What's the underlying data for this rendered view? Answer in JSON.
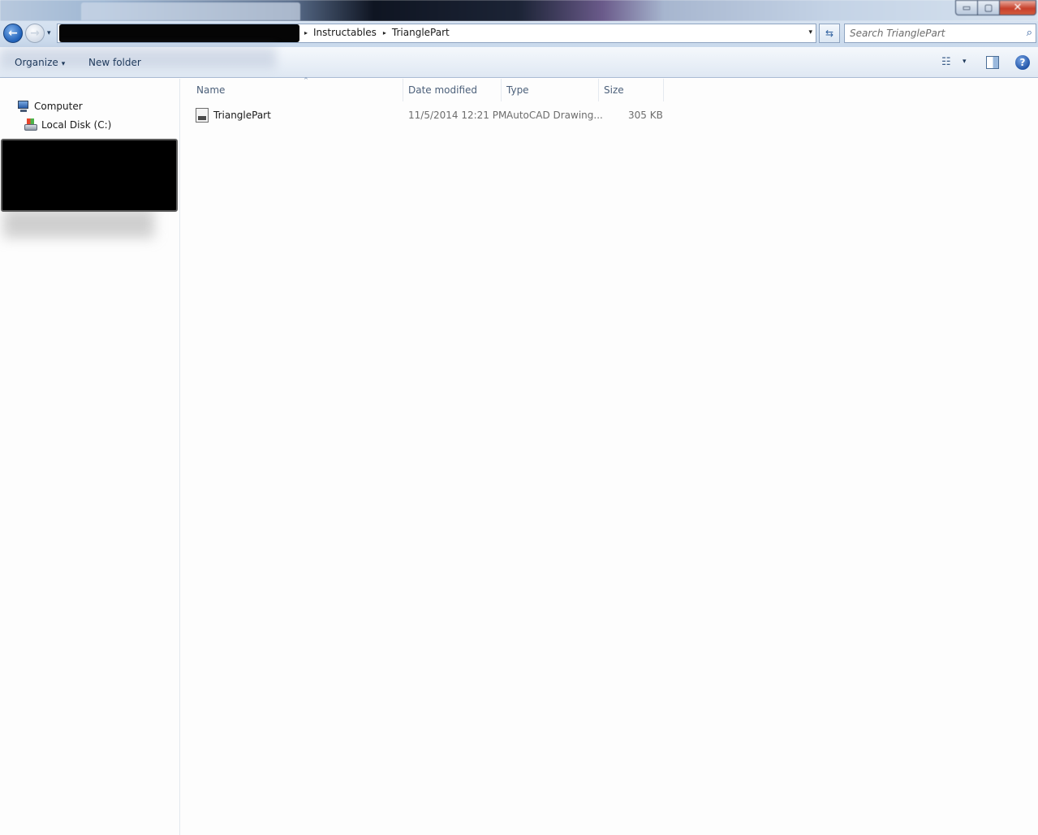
{
  "window": {
    "min_glyph": "▭",
    "max_glyph": "▢",
    "close_glyph": "✕"
  },
  "nav": {
    "back_glyph": "←",
    "forward_glyph": "→",
    "dropdown_glyph": "▾"
  },
  "address": {
    "crumb_sep": "▸",
    "crumbs": [
      "Instructables",
      "TrianglePart"
    ],
    "dropdown_glyph": "▾",
    "refresh_glyph": "⇆"
  },
  "search": {
    "placeholder": "Search TrianglePart",
    "icon_glyph": "⌕"
  },
  "toolbar": {
    "organize_label": "Organize",
    "organize_arrow": "▾",
    "new_folder_label": "New folder",
    "views_glyph": "☷",
    "views_drop_glyph": "▾",
    "help_glyph": "?"
  },
  "sidebar": {
    "items": [
      {
        "label": "Computer"
      },
      {
        "label": "Local Disk (C:)"
      }
    ]
  },
  "columns": {
    "name": "Name",
    "date_modified": "Date modified",
    "type": "Type",
    "size": "Size",
    "sort_glyph": "^"
  },
  "files": [
    {
      "name": "TrianglePart",
      "date_modified": "11/5/2014 12:21 PM",
      "type": "AutoCAD Drawing...",
      "size": "305 KB"
    }
  ],
  "colors": {
    "accent": "#1e395b",
    "redaction": "#000000"
  }
}
